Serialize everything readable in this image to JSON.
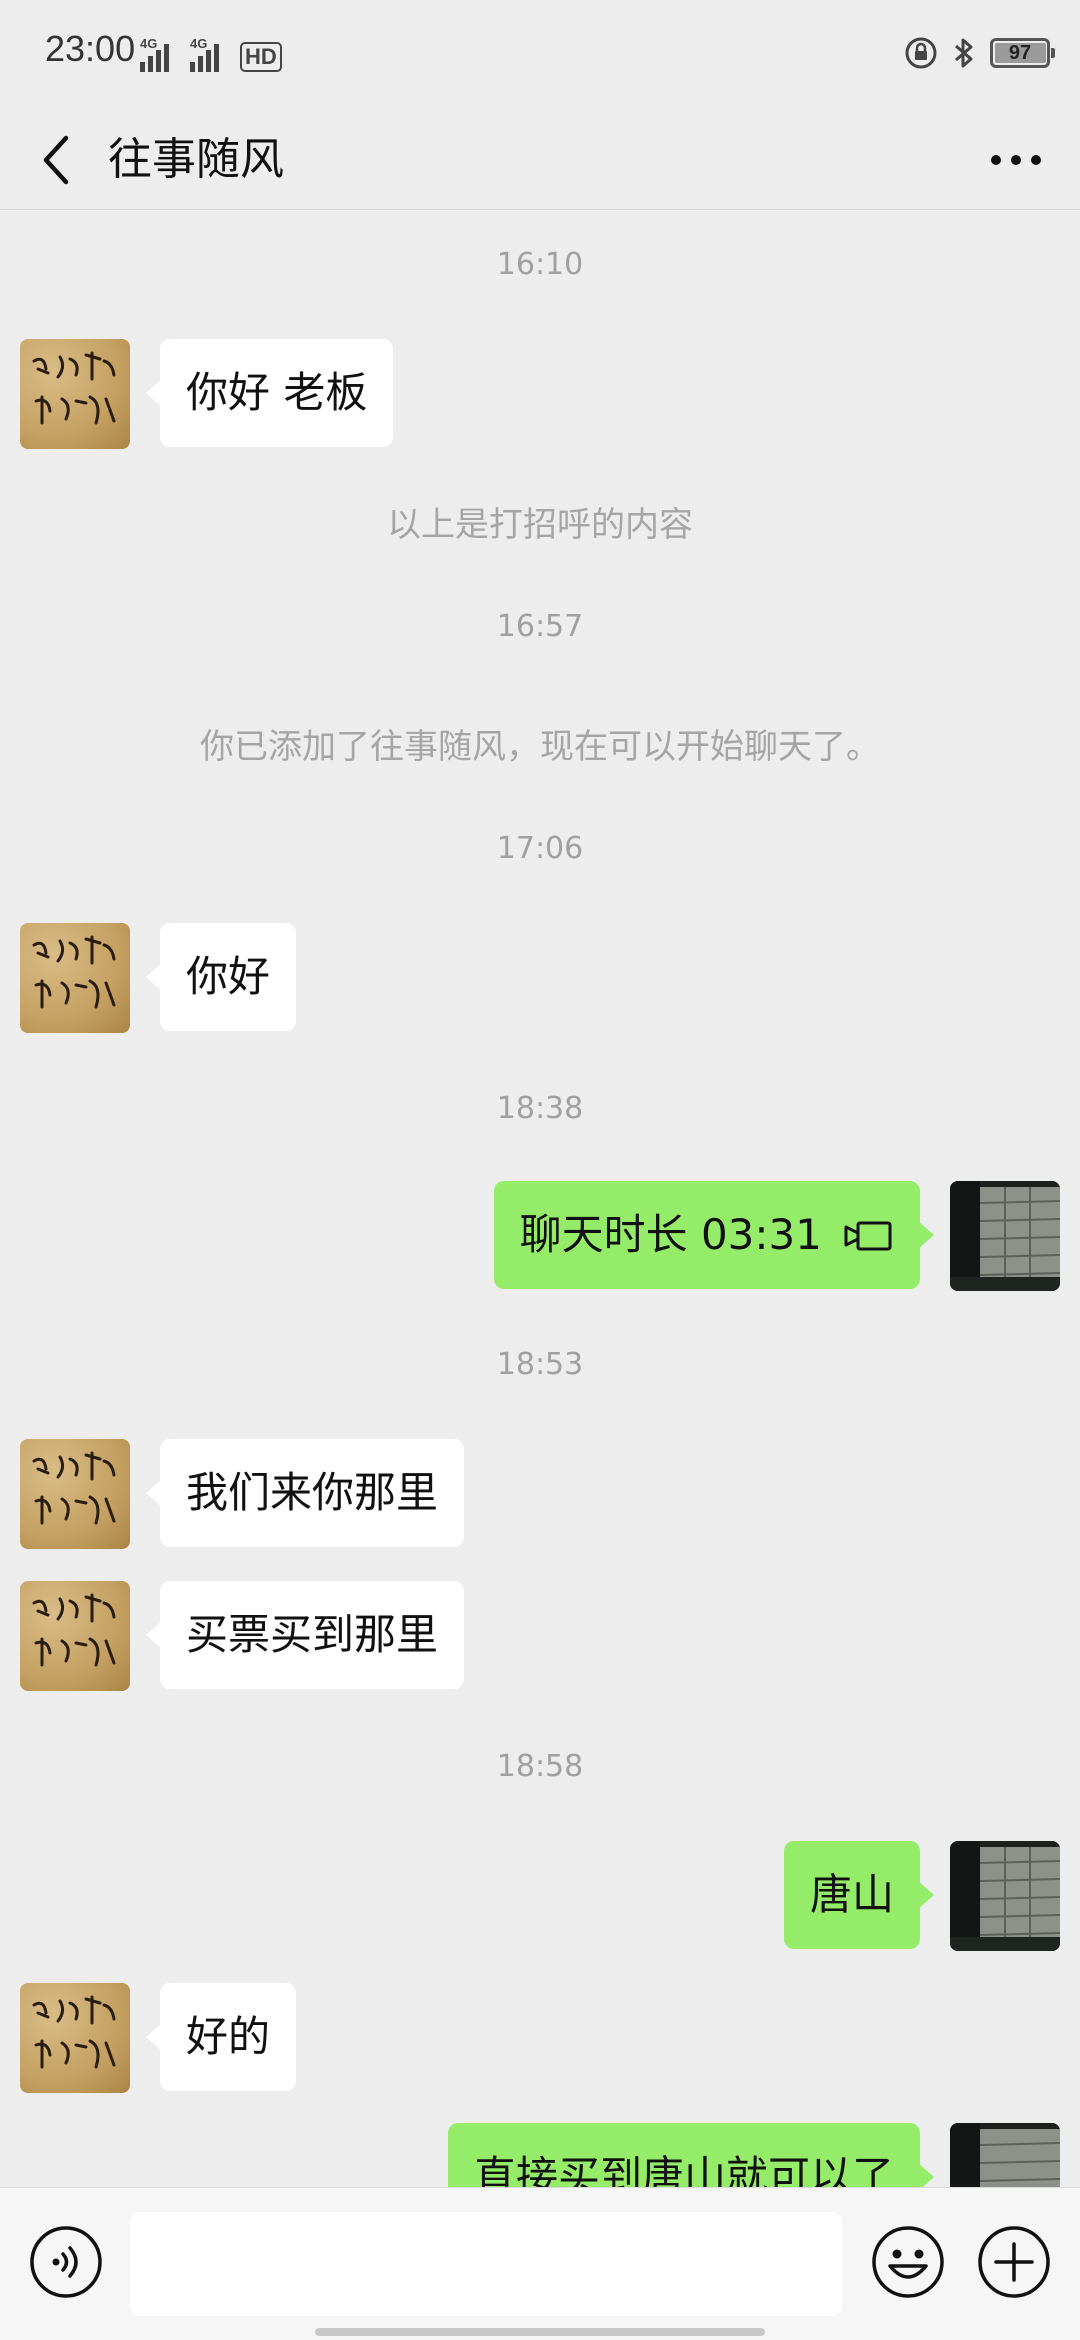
{
  "status_bar": {
    "time": "23:00",
    "network_1": "4G",
    "network_2": "4G",
    "hd_label": "HD",
    "battery": "97",
    "icons": [
      "signal-icon",
      "signal-icon",
      "hd-icon",
      "rotation-lock-icon",
      "bluetooth-icon",
      "battery-icon"
    ]
  },
  "header": {
    "title": "往事随风",
    "back_icon": "chevron-left-icon",
    "more_icon": "more-dots-icon"
  },
  "chat": {
    "items": [
      {
        "kind": "timestamp",
        "text": "16:10"
      },
      {
        "kind": "message",
        "from": "them",
        "text": "你好 老板"
      },
      {
        "kind": "system",
        "text": "以上是打招呼的内容"
      },
      {
        "kind": "timestamp",
        "text": "16:57"
      },
      {
        "kind": "system",
        "text": "你已添加了往事随风，现在可以开始聊天了。"
      },
      {
        "kind": "timestamp",
        "text": "17:06"
      },
      {
        "kind": "message",
        "from": "them",
        "text": "你好"
      },
      {
        "kind": "timestamp",
        "text": "18:38"
      },
      {
        "kind": "call",
        "from": "me",
        "text": "聊天时长 03:31",
        "icon": "video-call-icon"
      },
      {
        "kind": "timestamp",
        "text": "18:53"
      },
      {
        "kind": "message",
        "from": "them",
        "text": "我们来你那里"
      },
      {
        "kind": "message",
        "from": "them",
        "text": "买票买到那里"
      },
      {
        "kind": "timestamp",
        "text": "18:58"
      },
      {
        "kind": "message",
        "from": "me",
        "text": "唐山"
      },
      {
        "kind": "message",
        "from": "them",
        "text": "好的"
      },
      {
        "kind": "message",
        "from": "me",
        "text": "直接买到唐山就可以了"
      }
    ]
  },
  "input_bar": {
    "voice_icon": "voice-icon",
    "input_value": "",
    "emoji_icon": "emoji-icon",
    "plus_icon": "plus-icon"
  },
  "colors": {
    "background": "#ededed",
    "bubble_me": "#95ec69",
    "bubble_them": "#ffffff",
    "timestamp": "#a0a0a0"
  }
}
